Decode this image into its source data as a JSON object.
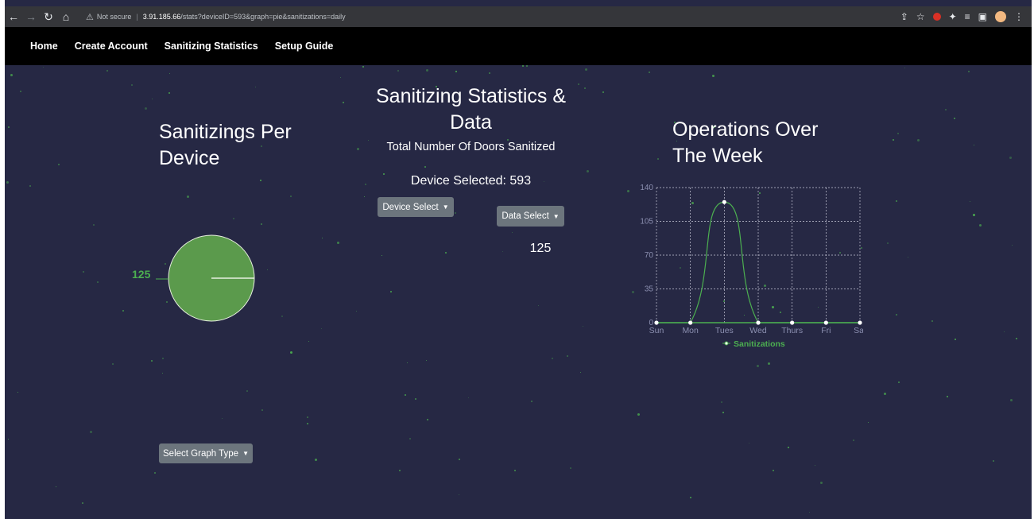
{
  "browser": {
    "security_label": "Not secure",
    "url_host": "3.91.185.66",
    "url_path": "/stats?deviceID=593&graph=pie&sanitizations=daily"
  },
  "nav": {
    "items": [
      "Home",
      "Create Account",
      "Sanitizing Statistics",
      "Setup Guide"
    ]
  },
  "left_panel": {
    "title_line1": "Sanitizings Per",
    "title_line2": "Device",
    "pie_label": "125",
    "graph_type_button": "Select Graph Type"
  },
  "center_panel": {
    "title_line1": "Sanitizing Statistics &",
    "title_line2": "Data",
    "subtitle": "Total Number Of Doors Sanitized",
    "device_selected": "Device Selected: 593",
    "device_select_button": "Device Select",
    "data_select_button": "Data Select",
    "total_value": "125"
  },
  "right_panel": {
    "title_line1": "Operations Over",
    "title_line2": "The Week"
  },
  "colors": {
    "background": "#262844",
    "accent_green": "#4caf50",
    "pie_fill": "#5b9a4c",
    "button_gray": "#6c757d",
    "navbar": "#000000"
  },
  "chart_data": [
    {
      "type": "pie",
      "title": "",
      "labels": [
        "125"
      ],
      "values": [
        125
      ]
    },
    {
      "type": "line",
      "title": "",
      "categories": [
        "Sun",
        "Mon",
        "Tues",
        "Wed",
        "Thurs",
        "Fri",
        "Sat"
      ],
      "series": [
        {
          "name": "Sanitizations",
          "values": [
            0,
            0,
            125,
            0,
            0,
            0,
            0
          ]
        }
      ],
      "yticks": [
        0,
        35,
        70,
        105,
        140
      ],
      "ylim": [
        0,
        140
      ],
      "grid": true,
      "legend": "bottom",
      "xlabel": "",
      "ylabel": ""
    }
  ]
}
